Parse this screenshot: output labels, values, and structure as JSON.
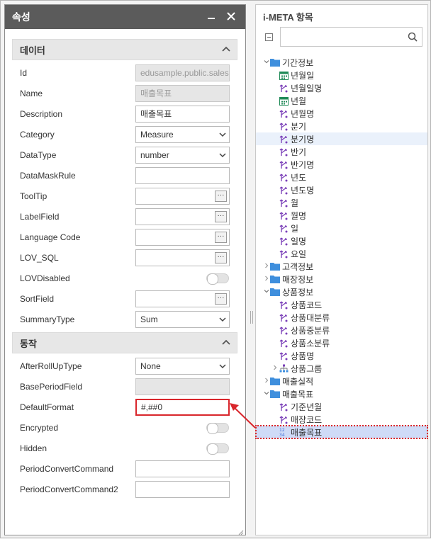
{
  "left": {
    "title": "속성",
    "minimize_icon": "▬",
    "close_icon": "✕",
    "sections": {
      "data": {
        "title": "데이터",
        "rows": [
          {
            "label": "Id",
            "value": "edusample.public.sales"
          },
          {
            "label": "Name",
            "value": "매출목표"
          },
          {
            "label": "Description",
            "value": "매출목표"
          },
          {
            "label": "Category",
            "value": "Measure"
          },
          {
            "label": "DataType",
            "value": "number"
          },
          {
            "label": "DataMaskRule",
            "value": ""
          },
          {
            "label": "ToolTip",
            "value": ""
          },
          {
            "label": "LabelField",
            "value": ""
          },
          {
            "label": "Language Code",
            "value": ""
          },
          {
            "label": "LOV_SQL",
            "value": ""
          },
          {
            "label": "LOVDisabled",
            "value": ""
          },
          {
            "label": "SortField",
            "value": ""
          },
          {
            "label": "SummaryType",
            "value": "Sum"
          }
        ]
      },
      "action": {
        "title": "동작",
        "rows": [
          {
            "label": "AfterRollUpType",
            "value": "None"
          },
          {
            "label": "BasePeriodField",
            "value": ""
          },
          {
            "label": "DefaultFormat",
            "value": "#,##0"
          },
          {
            "label": "Encrypted",
            "value": ""
          },
          {
            "label": "Hidden",
            "value": ""
          },
          {
            "label": "PeriodConvertCommand",
            "value": ""
          },
          {
            "label": "PeriodConvertCommand2",
            "value": ""
          }
        ]
      }
    }
  },
  "right": {
    "title": "i-META 항목",
    "search_placeholder": "",
    "tree": [
      {
        "label": "기간정보",
        "type": "folder",
        "level": 0,
        "expanded": true
      },
      {
        "label": "년월일",
        "type": "calendar",
        "level": 1
      },
      {
        "label": "년월일명",
        "type": "dim",
        "level": 1
      },
      {
        "label": "년월",
        "type": "calendar",
        "level": 1
      },
      {
        "label": "년월명",
        "type": "dim",
        "level": 1
      },
      {
        "label": "분기",
        "type": "dim",
        "level": 1
      },
      {
        "label": "분기명",
        "type": "dim",
        "level": 1,
        "hover": true
      },
      {
        "label": "반기",
        "type": "dim",
        "level": 1
      },
      {
        "label": "반기명",
        "type": "dim",
        "level": 1
      },
      {
        "label": "년도",
        "type": "dim",
        "level": 1
      },
      {
        "label": "년도명",
        "type": "dim",
        "level": 1
      },
      {
        "label": "월",
        "type": "dim",
        "level": 1
      },
      {
        "label": "월명",
        "type": "dim",
        "level": 1
      },
      {
        "label": "일",
        "type": "dim",
        "level": 1
      },
      {
        "label": "일명",
        "type": "dim",
        "level": 1
      },
      {
        "label": "요일",
        "type": "dim",
        "level": 1
      },
      {
        "label": "고객정보",
        "type": "folder",
        "level": 0,
        "expanded": false
      },
      {
        "label": "매장정보",
        "type": "folder",
        "level": 0,
        "expanded": false
      },
      {
        "label": "상품정보",
        "type": "folder",
        "level": 0,
        "expanded": true
      },
      {
        "label": "상품코드",
        "type": "dim",
        "level": 1
      },
      {
        "label": "상품대분류",
        "type": "dim",
        "level": 1
      },
      {
        "label": "상품중분류",
        "type": "dim",
        "level": 1
      },
      {
        "label": "상품소분류",
        "type": "dim",
        "level": 1
      },
      {
        "label": "상품명",
        "type": "dim",
        "level": 1
      },
      {
        "label": "상품그룹",
        "type": "group",
        "level": 1,
        "expanded": false
      },
      {
        "label": "매출실적",
        "type": "folder",
        "level": 0,
        "expanded": false
      },
      {
        "label": "매출목표",
        "type": "folder",
        "level": 0,
        "expanded": true
      },
      {
        "label": "기준년월",
        "type": "dim",
        "level": 1
      },
      {
        "label": "매장코드",
        "type": "dim",
        "level": 1
      },
      {
        "label": "매출목표",
        "type": "measure",
        "level": 1,
        "selected": true
      }
    ]
  },
  "colors": {
    "header": "#5b5b5b",
    "highlight_red": "#d9262c",
    "folder_blue": "#3f8fdd",
    "dim_purple": "#7a3fb8",
    "calendar_green": "#1f8a57",
    "selected_bg": "#cfdbf7"
  }
}
